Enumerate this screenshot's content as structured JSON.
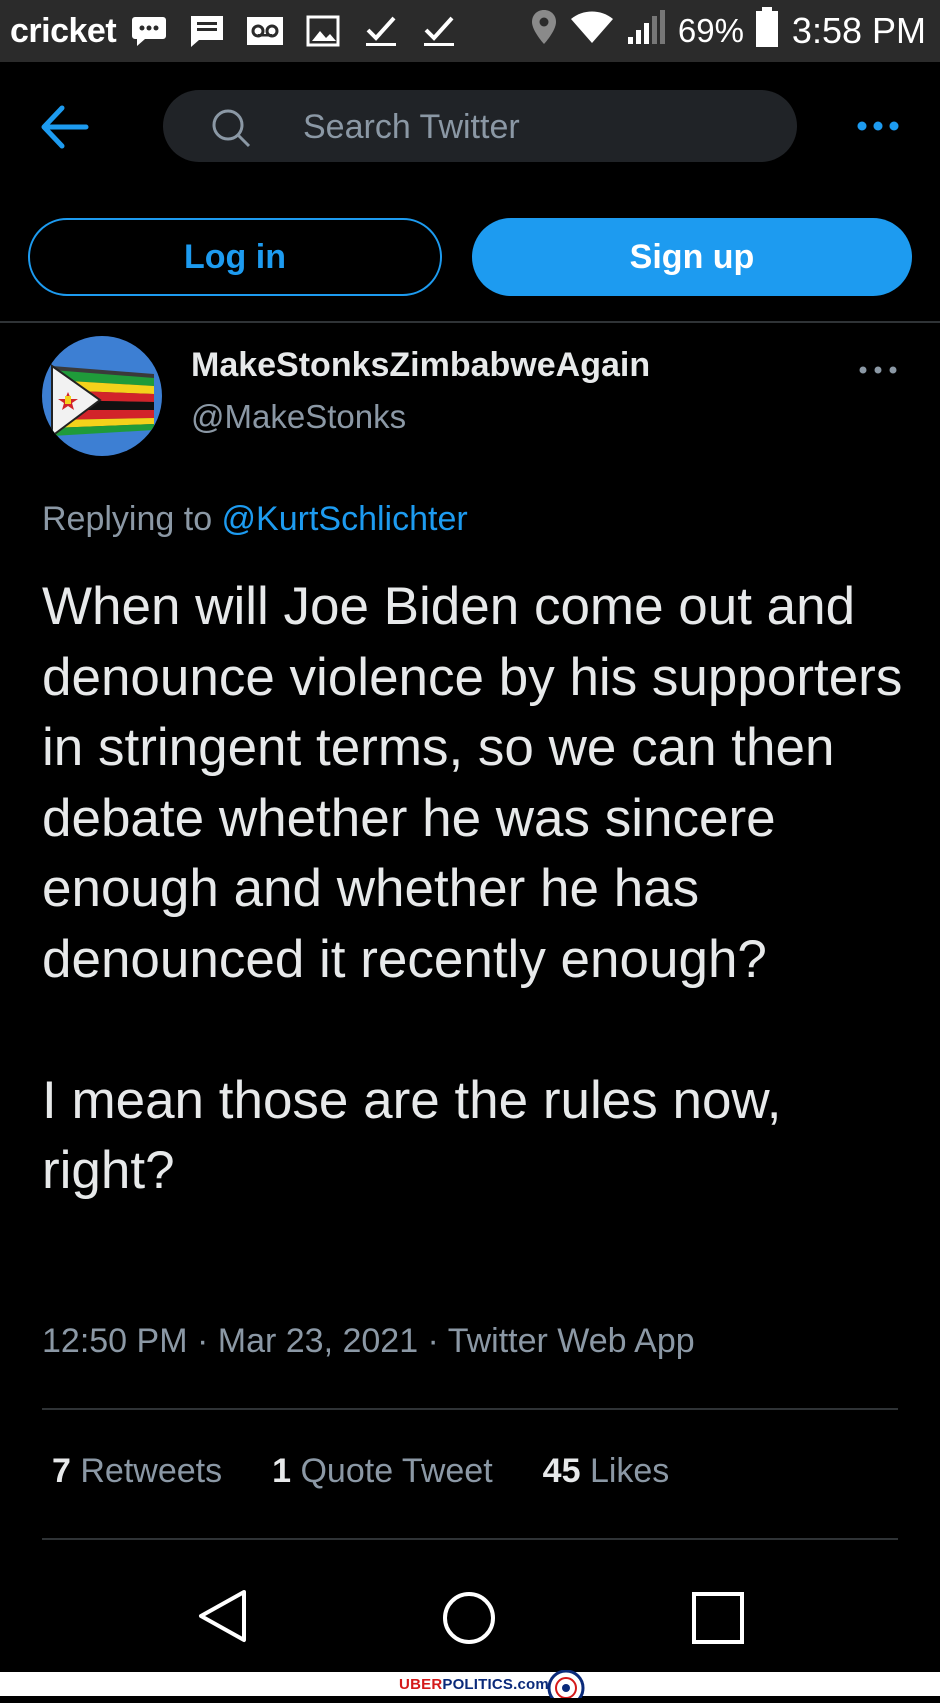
{
  "status_bar": {
    "carrier": "cricket",
    "battery": "69%",
    "time": "3:58 PM",
    "left_icons": [
      "messenger-icon",
      "message-icon",
      "voicemail-icon",
      "gallery-icon",
      "check-icon",
      "check-icon"
    ],
    "right_icons": [
      "location-icon",
      "wifi-icon",
      "signal-icon",
      "battery-icon"
    ]
  },
  "search": {
    "placeholder": "Search Twitter"
  },
  "auth": {
    "login_label": "Log in",
    "signup_label": "Sign up"
  },
  "tweet": {
    "display_name": "MakeStonksZimbabweAgain",
    "handle": "@MakeStonks",
    "replying_prefix": "Replying to ",
    "replying_to": "@KurtSchlichter",
    "text": "When will Joe Biden come out and denounce violence by his supporters in stringent terms, so we can then debate whether he was sincere enough and whether he has denounced it recently enough?\n\nI mean those are the rules now, right?",
    "time": "12:50 PM",
    "date": "Mar 23, 2021",
    "separator": " · ",
    "source": "Twitter Web App",
    "stats": [
      {
        "count": "7",
        "label": "Retweets"
      },
      {
        "count": "1",
        "label": "Quote Tweet"
      },
      {
        "count": "45",
        "label": "Likes"
      }
    ]
  },
  "watermark": {
    "prefix": "UBER",
    "rest": "POLITICS.com"
  },
  "colors": {
    "accent": "#1d9bf0",
    "background": "#000000",
    "muted": "#8b98a5",
    "text": "#e7e9ea"
  }
}
